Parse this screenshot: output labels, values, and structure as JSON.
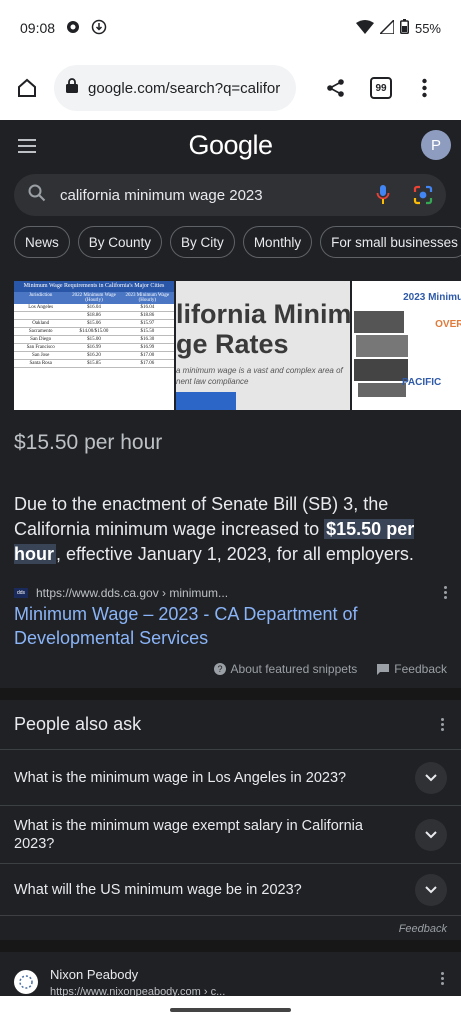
{
  "status_bar": {
    "time": "09:08",
    "battery": "55%"
  },
  "browser": {
    "url": "google.com/search?q=califor",
    "tab_count": "99"
  },
  "google": {
    "logo": "Google",
    "avatar_initial": "P"
  },
  "search": {
    "query": "california minimum wage 2023"
  },
  "chips": [
    "News",
    "By County",
    "By City",
    "Monthly",
    "For small businesses"
  ],
  "images": {
    "img1": {
      "title": "Minimum Wage Requirements in California's Major Cities",
      "headers": [
        "Jurisdiction",
        "2022 Minimum Wage (Hourly)",
        "2023 Minimum Wage (Hourly)"
      ],
      "rows": [
        [
          "Los Angeles",
          "$16.04",
          "$16.04"
        ],
        [
          "",
          "$18.86",
          "$18.86"
        ],
        [
          "Oakland",
          "$15.06",
          "$15.97"
        ],
        [
          "Sacramento",
          "$14.00/$15.00",
          "$15.50"
        ],
        [
          "San Diego",
          "$15.00",
          "$16.30"
        ],
        [
          "San Francisco",
          "$16.99",
          "$16.99"
        ],
        [
          "San Jose",
          "$16.20",
          "$17.00"
        ],
        [
          "Santa Rosa",
          "$15.85",
          "$17.06"
        ]
      ]
    },
    "img2": {
      "line1": "lifornia Minimu",
      "line2": "ge Rates",
      "caption": "a minimum wage is a vast and complex area of nent law compliance"
    },
    "img3": {
      "title": "2023 Minimum",
      "over": "OVERV",
      "logo": "PACIFIC"
    }
  },
  "snippet": {
    "answer": "$15.50 per hour",
    "body_before": "Due to the enactment of Senate Bill (SB) 3, the California minimum wage increased to ",
    "body_highlight": "$15.50 per hour",
    "body_after": ", effective January 1, 2023, for all employers.",
    "source_url": "https://www.dds.ca.gov › minimum...",
    "link_title": "Minimum Wage – 2023 - CA Department of Developmental Services",
    "about_label": "About featured snippets",
    "feedback_label": "Feedback"
  },
  "paa": {
    "title": "People also ask",
    "questions": [
      "What is the minimum wage in Los Angeles in 2023?",
      "What is the minimum wage exempt salary in California 2023?",
      "What will the US minimum wage be in 2023?"
    ],
    "feedback_label": "Feedback"
  },
  "next_result": {
    "name": "Nixon Peabody",
    "url": "https://www.nixonpeabody.com › c..."
  },
  "colors": {
    "background": "#202124",
    "link": "#8ab4f8",
    "highlight": "#394457"
  }
}
